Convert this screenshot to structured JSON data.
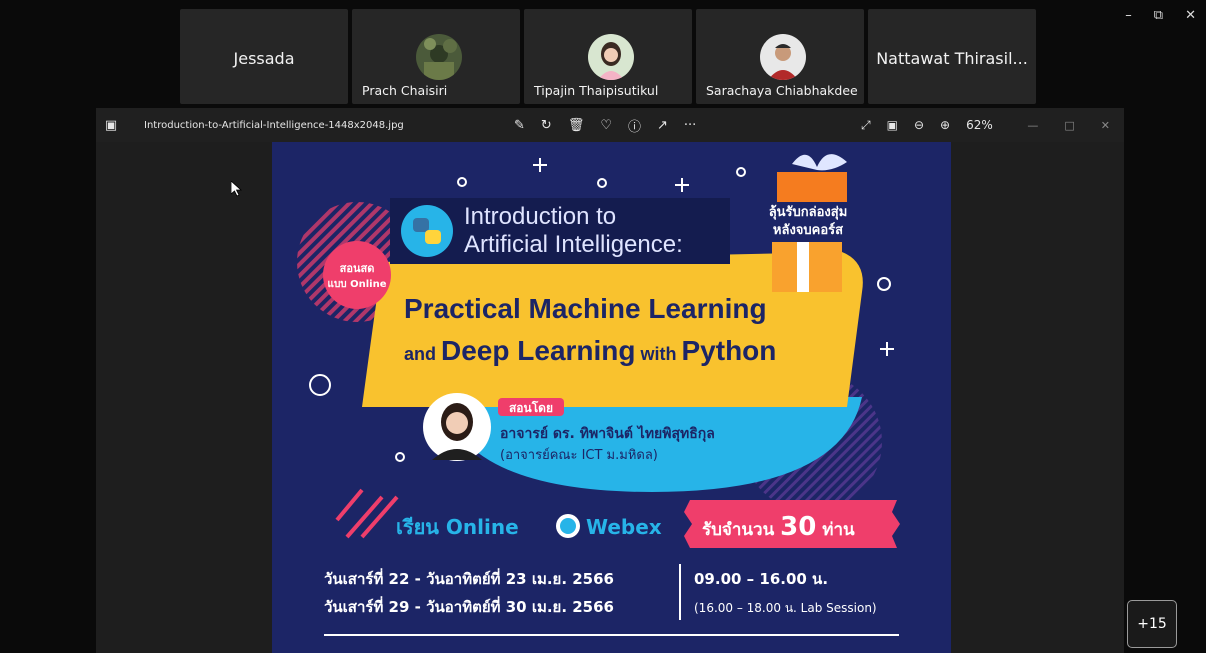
{
  "window_controls": {
    "minimize": "–",
    "restore": "⧉",
    "close": "✕"
  },
  "participants": [
    {
      "name": "Jessada",
      "has_video": false
    },
    {
      "name": "Prach Chaisiri",
      "has_video": true
    },
    {
      "name": "Tipajin Thaipisutikul",
      "has_video": true
    },
    {
      "name": "Sarachaya Chiabhakdee",
      "has_video": true
    },
    {
      "name": "Nattawat Thirasil...",
      "has_video": false
    }
  ],
  "more_participants": "+15",
  "viewer": {
    "filename": "Introduction-to-Artificial-Intelligence-1448x2048.jpg",
    "zoom": "62%",
    "tool_icons": [
      "edit-icon",
      "rotate-icon",
      "delete-icon",
      "favorite-icon",
      "info-icon",
      "share-icon",
      "more-icon"
    ],
    "right_icons": [
      "fullscreen-icon",
      "fit-icon",
      "zoom-out-icon",
      "zoom-in-icon"
    ]
  },
  "poster": {
    "title_line1": "Introduction to",
    "title_line2": "Artificial Intelligence:",
    "gift_line1": "ลุ้นรับกล่องสุ่ม",
    "gift_line2": "หลังจบคอร์ส",
    "badge_line1": "สอนสด",
    "badge_line2": "แบบ Online",
    "main_line1": "Practical Machine Learning",
    "main_line2_a": "and ",
    "main_line2_b": "Deep Learning",
    "main_line2_c": " with ",
    "main_line2_d": "Python",
    "taught_by": "สอนโดย",
    "teacher": "อาจารย์ ดร. ทิพาจินต์ ไทยพิสุทธิกุล",
    "teacher_affil": "(อาจารย์คณะ ICT ม.มหิดล)",
    "learn_online": "เรียน Online",
    "webex": "Webex",
    "seats_a": "รับจำนวน ",
    "seats_num": "30",
    "seats_b": " ท่าน",
    "date1": "วันเสาร์ที่ 22 - วันอาทิตย์ที่ 23 เม.ย. 2566",
    "date2": "วันเสาร์ที่ 29 - วันอาทิตย์ที่ 30 เม.ย. 2566",
    "time": "09.00 – 16.00 น.",
    "lab": "(16.00 – 18.00 น. Lab Session)"
  },
  "colors": {
    "poster_bg": "#1c2566",
    "yellow": "#f9c22e",
    "cyan": "#27b4e8",
    "pink": "#ef3e6b"
  }
}
